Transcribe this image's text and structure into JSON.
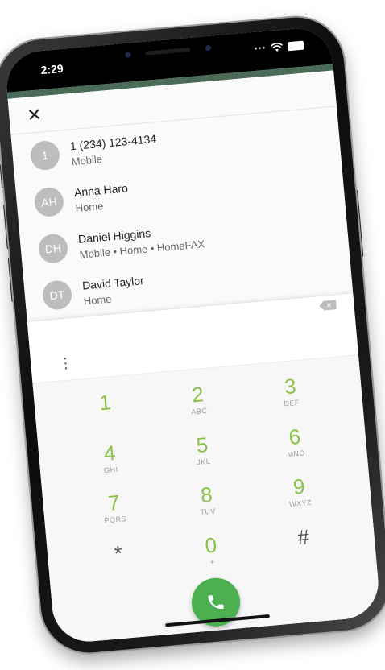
{
  "status_bar": {
    "time": "2:29",
    "dots": "•••",
    "wifi_icon": "wifi-icon",
    "battery_icon": "battery-icon"
  },
  "header": {
    "close_icon": "close-icon",
    "close_glyph": "✕"
  },
  "contacts": [
    {
      "initials": "1",
      "name": "1 (234) 123-4134",
      "detail": "Mobile"
    },
    {
      "initials": "AH",
      "name": "Anna Haro",
      "detail": "Home"
    },
    {
      "initials": "DH",
      "name": "Daniel Higgins",
      "detail": "Mobile • Home • HomeFAX"
    },
    {
      "initials": "DT",
      "name": "David Taylor",
      "detail": "Home"
    }
  ],
  "input": {
    "value": "",
    "backspace_icon": "backspace-icon",
    "backspace_glyph": "✕"
  },
  "menu": {
    "overflow_icon": "more-vert-icon",
    "overflow_glyph": "⋮"
  },
  "keypad": [
    {
      "digit": "1",
      "letters": ""
    },
    {
      "digit": "2",
      "letters": "ABC"
    },
    {
      "digit": "3",
      "letters": "DEF"
    },
    {
      "digit": "4",
      "letters": "GHI"
    },
    {
      "digit": "5",
      "letters": "JKL"
    },
    {
      "digit": "6",
      "letters": "MNO"
    },
    {
      "digit": "7",
      "letters": "PQRS"
    },
    {
      "digit": "8",
      "letters": "TUV"
    },
    {
      "digit": "9",
      "letters": "WXYZ"
    },
    {
      "digit": "*",
      "letters": ""
    },
    {
      "digit": "0",
      "letters": "+"
    },
    {
      "digit": "#",
      "letters": ""
    }
  ],
  "call_button": {
    "icon": "phone-icon"
  },
  "colors": {
    "accent_digits": "#8bc34a",
    "call_green": "#4caf50",
    "avatar_gray": "#bdbdbd",
    "header_strip": "#4a6b58"
  }
}
